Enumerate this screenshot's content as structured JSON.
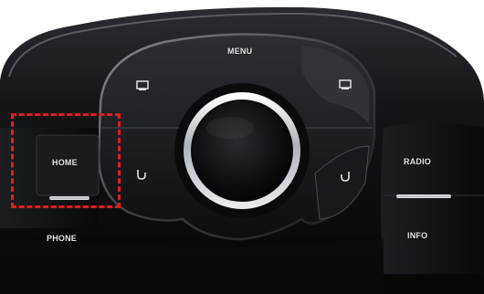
{
  "buttons": {
    "menu": "MENU",
    "home": "HOME",
    "phone": "PHONE",
    "radio": "RADIO",
    "info": "INFO"
  },
  "icons": {
    "upper_left": "screen-square-icon",
    "upper_right": "screen-square-icon",
    "lower_left": "back-u-turn-icon",
    "lower_right": "back-u-turn-icon"
  },
  "colors": {
    "highlight": "#e41b1b",
    "panel_dark": "#101013",
    "chrome": "#c9ccd1",
    "label": "#e6e6e6"
  }
}
